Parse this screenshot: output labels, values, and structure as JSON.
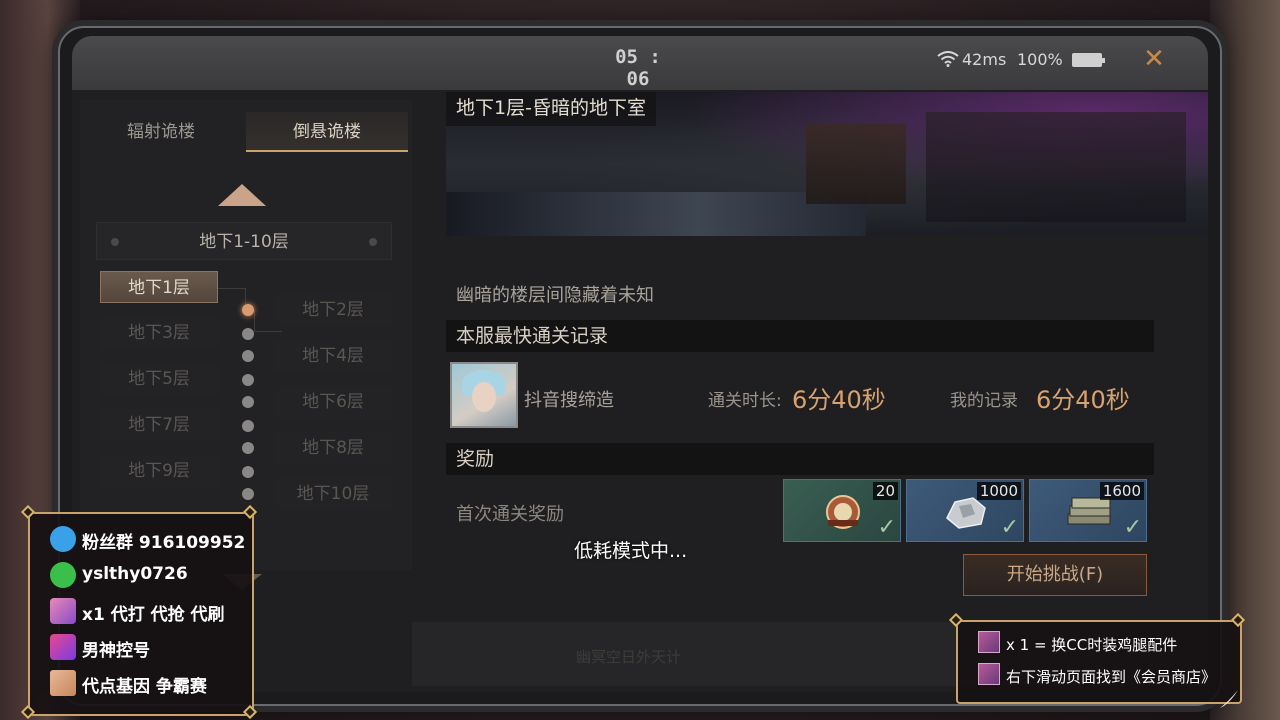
{
  "status_bar": {
    "time": "05 : 06",
    "ping": "42ms",
    "battery": "100%",
    "close_icon": "close-icon"
  },
  "tabs": [
    {
      "label": "辐射诡楼",
      "active": false
    },
    {
      "label": "倒悬诡楼",
      "active": true
    }
  ],
  "range_selector": "地下1-10层",
  "floors": [
    {
      "label": "地下1层",
      "active": true
    },
    {
      "label": "地下2层",
      "active": false
    },
    {
      "label": "地下3层",
      "active": false
    },
    {
      "label": "地下4层",
      "active": false
    },
    {
      "label": "地下5层",
      "active": false
    },
    {
      "label": "地下6层",
      "active": false
    },
    {
      "label": "地下7层",
      "active": false
    },
    {
      "label": "地下8层",
      "active": false
    },
    {
      "label": "地下9层",
      "active": false
    },
    {
      "label": "地下10层",
      "active": false
    }
  ],
  "detail": {
    "title": "地下1层-昏暗的地下室",
    "description": "幽暗的楼层间隐藏着未知",
    "record_header": "本服最快通关记录",
    "player_name": "抖音搜缔造",
    "clear_time_label": "通关时长:",
    "clear_time_value": "6分40秒",
    "my_record_label": "我的记录",
    "my_record_value": "6分40秒",
    "reward_header": "奖励",
    "first_clear_label": "首次通关奖励",
    "rewards": [
      {
        "count": "20",
        "icon": "badge-icon",
        "claimed": true
      },
      {
        "count": "1000",
        "icon": "silver-ore-icon",
        "claimed": true
      },
      {
        "count": "1600",
        "icon": "cash-stack-icon",
        "claimed": true
      }
    ],
    "start_button": "开始挑战(F)"
  },
  "bottom_hint": "幽冥空日外天计",
  "toast": "低耗模式中...",
  "stream_overlay_left": {
    "fan_group": "粉丝群 916109952",
    "wechat": "yslthy0726",
    "service": "x1 代打 代抢 代刷",
    "account": "男神控号",
    "gene": "代点基因 争霸赛"
  },
  "stream_overlay_right": {
    "line1": "x 1 = 换CC时装鸡腿配件",
    "line2": "右下滑动页面找到《会员商店》"
  },
  "colors": {
    "accent_gold": "#c9a36a",
    "record_orange": "#d8a270",
    "active_node": "#d89a70"
  }
}
